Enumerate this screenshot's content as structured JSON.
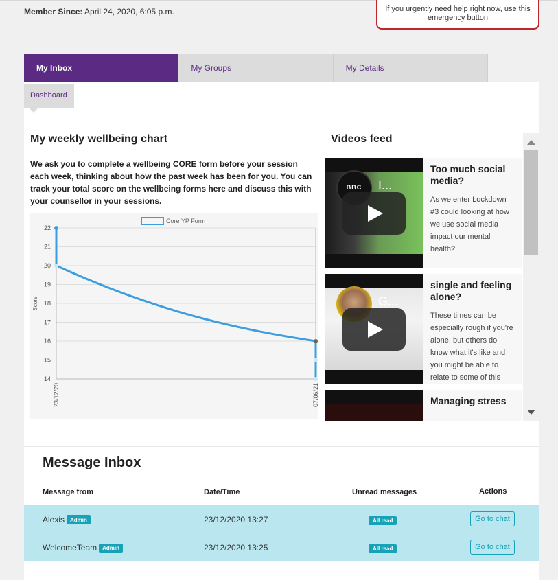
{
  "member": {
    "label": "Member Since:",
    "value": " April 24, 2020, 6:05 p.m."
  },
  "emergency": {
    "text": "If you urgently need help right now, use this emergency button"
  },
  "tabs": [
    {
      "label": "My Inbox",
      "active": true
    },
    {
      "label": "My Groups",
      "active": false
    },
    {
      "label": "My Details",
      "active": false
    }
  ],
  "subtab": {
    "label": "Dashboard"
  },
  "wellbeing": {
    "title": "My weekly wellbeing chart",
    "description": "We ask you to complete a wellbeing CORE form before your session each week, thinking about how the past week has been for you. You can track your total score on the wellbeing forms here and discuss this with your counsellor in your sessions."
  },
  "chart_data": {
    "type": "line",
    "legend": [
      "Core YP Form"
    ],
    "ylabel": "Score",
    "xlabel": "",
    "ylim": [
      14,
      22
    ],
    "yticks": [
      14,
      15,
      16,
      17,
      18,
      19,
      20,
      21,
      22
    ],
    "xticks": [
      "23/12/20",
      "07/06/21"
    ],
    "series": [
      {
        "name": "Core YP Form",
        "x": [
          "23/12/20",
          "23/12/20",
          "07/06/21",
          "07/06/21",
          "07/06/21"
        ],
        "values": [
          22,
          20,
          16,
          15,
          14
        ]
      }
    ],
    "color": "#3a9ee0",
    "grid": true,
    "legend_position": "top"
  },
  "videos": {
    "title": "Videos feed",
    "items": [
      {
        "title": "Too much social media?",
        "description": "As we enter Lockdown #3 could looking at how we use social media impact our mental health?",
        "thumb_title": "I...",
        "channel": "BBC"
      },
      {
        "title": "single and feeling alone?",
        "description": "These times can be especially rough if you're alone, but others do know what it's like and you might be able to relate to some of this",
        "thumb_title": "G...",
        "channel": ""
      },
      {
        "title": "Managing stress",
        "description": "",
        "thumb_title": "",
        "channel": ""
      }
    ]
  },
  "inbox": {
    "title": "Message Inbox",
    "columns": [
      "Message from",
      "Date/Time",
      "Unread messages",
      "Actions"
    ],
    "rows": [
      {
        "from": "Alexis",
        "role": "Admin",
        "datetime": "23/12/2020 13:27",
        "unread": "All read",
        "action": "Go to chat"
      },
      {
        "from": "WelcomeTeam",
        "role": "Admin",
        "datetime": "23/12/2020 13:25",
        "unread": "All read",
        "action": "Go to chat"
      }
    ]
  },
  "colors": {
    "brand": "#5b2a83",
    "accent": "#17a2b8",
    "row_bg": "#b9e6ef",
    "emergency": "#c0272d"
  }
}
